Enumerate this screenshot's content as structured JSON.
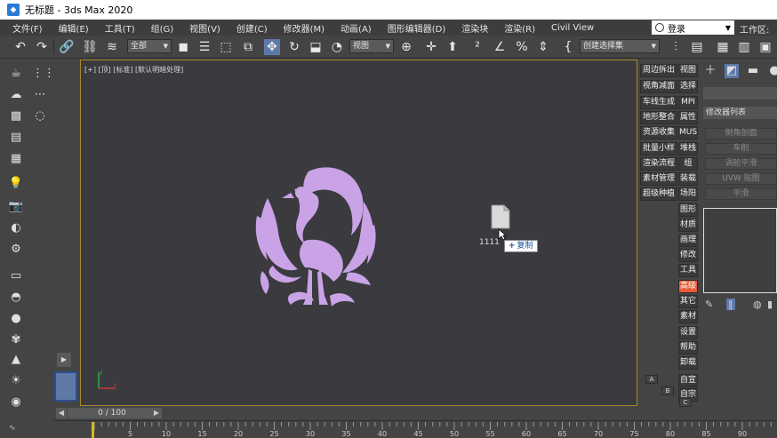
{
  "window": {
    "title": "无标题 - 3ds Max 2020"
  },
  "menu": {
    "items": [
      "文件(F)",
      "编辑(E)",
      "工具(T)",
      "组(G)",
      "视图(V)",
      "创建(C)",
      "修改器(M)",
      "动画(A)",
      "图形编辑器(D)",
      "渲染块",
      "渲染(R)",
      "Civil View"
    ],
    "login": "登录",
    "workspace": "工作区:"
  },
  "toolbar": {
    "filter_select": "全部",
    "ref_coord_select": "视图",
    "selection_set_select": "创建选择集"
  },
  "viewport": {
    "label": "[+] [顶] [标准] [默认明暗处理]",
    "file_name": "1111",
    "copy_tip": "复制",
    "phoenix_color": "#c9a3e6",
    "border_color": "#a6892b"
  },
  "plugin_panel": {
    "left_col": [
      "周边拆出",
      "视角减面",
      "车线生成",
      "地形整合",
      "资源收集",
      "批量小样",
      "渲染流程",
      "素材管理",
      "超级种植"
    ],
    "right_col": [
      "视图",
      "选择",
      "MPI",
      "属性",
      "MUS",
      "堆栈",
      "组",
      "装载",
      "场阳",
      "图形",
      "材质",
      "画理",
      "修改",
      "工具",
      "高级",
      "其它",
      "素材",
      "设置",
      "帮助",
      "卸载",
      "自宣",
      "自宗"
    ],
    "active_item": "高级",
    "letters": [
      "A",
      "B",
      "C"
    ]
  },
  "command_panel": {
    "modifier_list": "修改器列表",
    "buttons": [
      "倒角剖面",
      "车削",
      "涡轮平滑",
      "UVW 贴图",
      "平滑"
    ]
  },
  "timeline": {
    "frame_display": "0 / 100",
    "tick_labels": [
      "5",
      "10",
      "15",
      "20",
      "25",
      "30",
      "35",
      "40",
      "45",
      "50",
      "55",
      "60",
      "65",
      "70",
      "75",
      "80",
      "85",
      "90"
    ]
  }
}
